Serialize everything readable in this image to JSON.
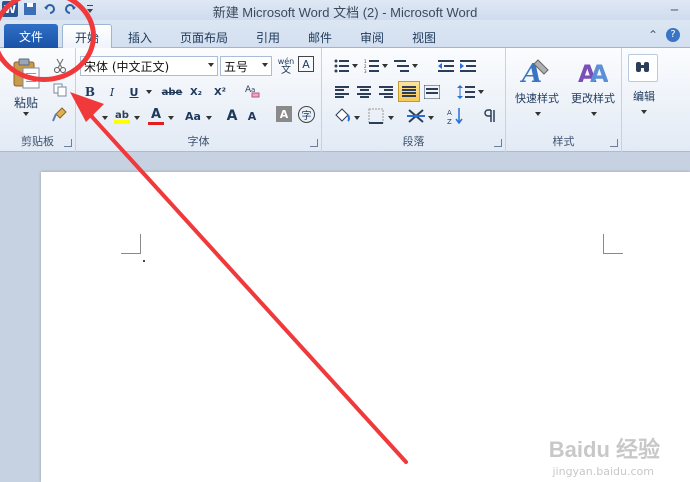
{
  "window": {
    "title": "新建 Microsoft Word 文档 (2) - Microsoft Word"
  },
  "tabs": {
    "file": "文件",
    "items": [
      "开始",
      "插入",
      "页面布局",
      "引用",
      "邮件",
      "审阅",
      "视图"
    ],
    "active": "开始"
  },
  "ribbon": {
    "clipboard": {
      "label": "剪贴板",
      "paste": "粘贴"
    },
    "font": {
      "label": "字体",
      "font_name": "宋体 (中文正文)",
      "font_size": "五号",
      "bold": "B",
      "italic": "I",
      "underline": "U",
      "strikethrough": "abe",
      "subscript": "X₂",
      "superscript": "X²",
      "change_case": "Aa",
      "grow": "A",
      "shrink": "A",
      "char_border": "A",
      "enclose": "字",
      "phonetic": "wén",
      "char_box": "A",
      "font_color": "A",
      "text_effect": "A"
    },
    "paragraph": {
      "label": "段落"
    },
    "styles": {
      "label": "样式",
      "quick_styles": "快速样式",
      "change_styles": "更改样式"
    },
    "editing": {
      "label": "编辑"
    }
  },
  "watermark": {
    "brand": "Baidu 经验",
    "url": "jingyan.baidu.com"
  },
  "colors": {
    "file_tab": "#1a53a6",
    "annotation": "#f0393b",
    "highlight": "#f9c853",
    "font_color_bar": "#e02020"
  }
}
